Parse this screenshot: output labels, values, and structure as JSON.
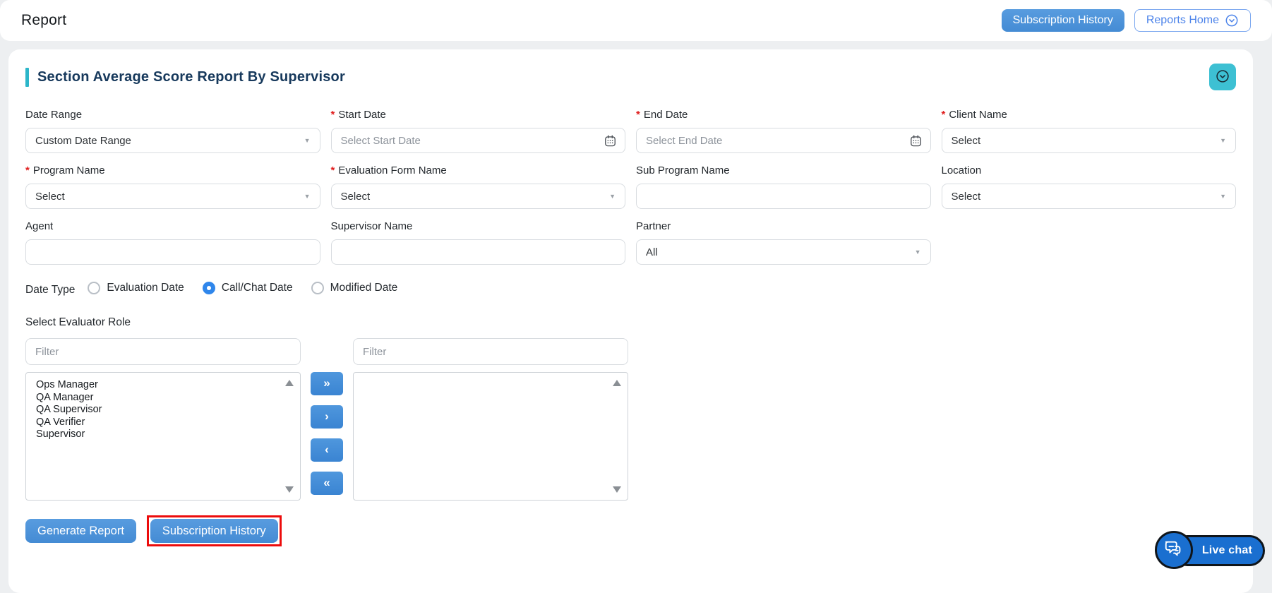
{
  "header": {
    "title": "Report",
    "buttons": {
      "subscription_history": "Subscription History",
      "reports_home": "Reports Home"
    }
  },
  "panel": {
    "title": "Section Average Score Report By Supervisor"
  },
  "required_marker": "*",
  "form": {
    "date_range": {
      "label": "Date Range",
      "value": "Custom Date Range"
    },
    "start_date": {
      "label": "Start Date",
      "required": true,
      "placeholder": "Select Start Date"
    },
    "end_date": {
      "label": "End Date",
      "required": true,
      "placeholder": "Select End Date"
    },
    "client_name": {
      "label": "Client Name",
      "required": true,
      "value": "Select"
    },
    "program_name": {
      "label": "Program Name",
      "required": true,
      "value": "Select"
    },
    "evaluation_form_name": {
      "label": "Evaluation Form Name",
      "required": true,
      "value": "Select"
    },
    "sub_program_name": {
      "label": "Sub Program Name",
      "value": ""
    },
    "location": {
      "label": "Location",
      "value": "Select"
    },
    "agent": {
      "label": "Agent",
      "value": ""
    },
    "supervisor_name": {
      "label": "Supervisor Name",
      "value": ""
    },
    "partner": {
      "label": "Partner",
      "value": "All"
    }
  },
  "date_type": {
    "label": "Date Type",
    "options": [
      {
        "label": "Evaluation Date",
        "selected": false
      },
      {
        "label": "Call/Chat Date",
        "selected": true
      },
      {
        "label": "Modified Date",
        "selected": false
      }
    ]
  },
  "evaluator_role": {
    "label": "Select Evaluator Role",
    "filter_placeholder": "Filter",
    "available": [
      "Ops Manager",
      "QA Manager",
      "QA Supervisor",
      "QA Verifier",
      "Supervisor"
    ],
    "selected": [],
    "transfer": {
      "all_right": "»",
      "right": "›",
      "left": "‹",
      "all_left": "«"
    }
  },
  "actions": {
    "generate_report": "Generate Report",
    "subscription_history": "Subscription History"
  },
  "live_chat": {
    "label": "Live chat"
  },
  "colors": {
    "primary_blue": "#4b92da",
    "teal_accent": "#2cb6c9",
    "collapse_teal": "#3dc0d3",
    "title_navy": "#17395c",
    "required_red": "#e01e1e",
    "highlight_red": "#ec0c0c",
    "livechat_blue": "#1a6fd0"
  }
}
